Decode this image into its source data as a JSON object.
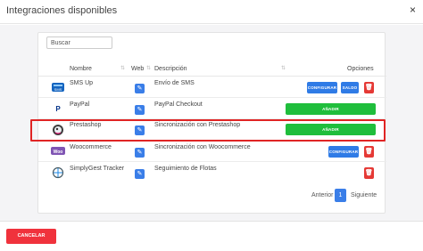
{
  "header": {
    "title": "Integraciones disponibles",
    "close_label": "×"
  },
  "search": {
    "placeholder": "Buscar"
  },
  "table": {
    "columns": {
      "name": "Nombre",
      "web": "Web",
      "description": "Descripción",
      "options": "Opciones"
    },
    "rows": [
      {
        "name": "SMS Up",
        "description": "Envío de SMS",
        "icon": "sms-up-logo-icon",
        "configure_label": "CONFIGURAR",
        "balance_label": "SALDO",
        "delete_icon": "trash-icon"
      },
      {
        "name": "PayPal",
        "description": "PayPal Checkout",
        "icon": "paypal-logo-icon",
        "add_label": "AÑADIR"
      },
      {
        "name": "Prestashop",
        "description": "Sincronización con Prestashop",
        "icon": "prestashop-logo-icon",
        "add_label": "AÑADIR",
        "highlighted": true
      },
      {
        "name": "Woocommerce",
        "description": "Sincronización con Woocommerce",
        "icon": "woocommerce-logo-icon",
        "configure_label": "CONFIGURAR",
        "delete_icon": "trash-icon"
      },
      {
        "name": "SimplyGest Tracker",
        "description": "Seguimiento de Flotas",
        "icon": "simplygest-tracker-logo-icon",
        "delete_icon": "trash-icon"
      }
    ]
  },
  "pagination": {
    "previous": "Anterior",
    "current": "1",
    "next": "Siguiente"
  },
  "footer": {
    "cancel_label": "CANCELAR"
  },
  "colors": {
    "primary_blue": "#2f7be6",
    "danger_red": "#e53935",
    "success_green": "#1fbe3c",
    "highlight_border": "#e02424"
  }
}
